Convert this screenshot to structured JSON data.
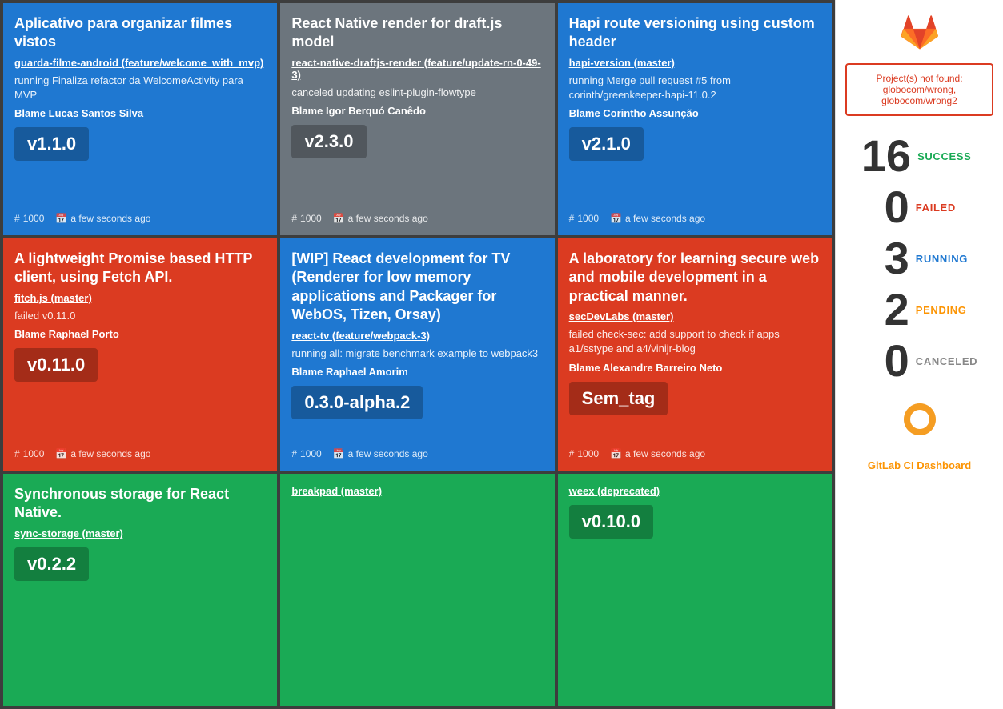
{
  "cards": [
    {
      "id": "card-1",
      "status": "blue",
      "title": "Aplicativo para organizar filmes vistos",
      "repo": "guarda-filme-android (feature/welcome_with_mvp)",
      "description": "running Finaliza refactor da WelcomeActivity para MVP",
      "blame": "Blame Lucas Santos Silva",
      "version": "v1.1.0",
      "build_number": "1000",
      "time": "a few seconds ago"
    },
    {
      "id": "card-2",
      "status": "gray",
      "title": "React Native render for draft.js model",
      "repo": "react-native-draftjs-render (feature/update-rn-0-49-3)",
      "description": "canceled updating eslint-plugin-flowtype",
      "blame": "Blame Igor Berquó Canêdo",
      "version": "v2.3.0",
      "build_number": "1000",
      "time": "a few seconds ago"
    },
    {
      "id": "card-3",
      "status": "blue",
      "title": "Hapi route versioning using custom header",
      "repo": "hapi-version (master)",
      "description": "running Merge pull request #5 from corinth/greenkeeper-hapi-11.0.2",
      "blame": "Blame Corintho Assunção",
      "version": "v2.1.0",
      "build_number": "1000",
      "time": "a few seconds ago"
    },
    {
      "id": "card-4",
      "status": "red",
      "title": "A lightweight Promise based HTTP client, using Fetch API.",
      "repo": "fitch.js (master)",
      "description": "failed v0.11.0",
      "blame": "Blame Raphael Porto",
      "version": "v0.11.0",
      "build_number": "1000",
      "time": "a few seconds ago"
    },
    {
      "id": "card-5",
      "status": "blue",
      "title": "[WIP] React development for TV (Renderer for low memory applications and Packager for WebOS, Tizen, Orsay)",
      "repo": "react-tv (feature/webpack-3)",
      "description": "running all: migrate benchmark example to webpack3",
      "blame": "Blame Raphael Amorim",
      "version": "0.3.0-alpha.2",
      "build_number": "1000",
      "time": "a few seconds ago"
    },
    {
      "id": "card-6",
      "status": "red",
      "title": "A laboratory for learning secure web and mobile development in a practical manner.",
      "repo": "secDevLabs (master)",
      "description": "failed check-sec: add support to check if apps a1/sstype and a4/vinijr-blog",
      "blame": "Blame Alexandre Barreiro Neto",
      "version": "Sem_tag",
      "build_number": "1000",
      "time": "a few seconds ago"
    },
    {
      "id": "card-7",
      "status": "green",
      "title": "Synchronous storage for React Native.",
      "repo": "sync-storage (master)",
      "description": "",
      "blame": "",
      "version": "v0.2.2",
      "build_number": "",
      "time": ""
    },
    {
      "id": "card-8",
      "status": "green",
      "title": "",
      "repo": "breakpad (master)",
      "description": "",
      "blame": "",
      "version": "",
      "build_number": "",
      "time": ""
    },
    {
      "id": "card-9",
      "status": "green",
      "title": "",
      "repo": "weex (deprecated)",
      "description": "",
      "blame": "",
      "version": "v0.10.0",
      "build_number": "",
      "time": ""
    }
  ],
  "sidebar": {
    "error_title": "Project(s) not found:",
    "error_projects": "globocom/wrong, globocom/wrong2",
    "stats": [
      {
        "number": "16",
        "label": "SUCCESS",
        "class": "success"
      },
      {
        "number": "0",
        "label": "FAILED",
        "class": "failed"
      },
      {
        "number": "3",
        "label": "RUNNING",
        "class": "running"
      },
      {
        "number": "2",
        "label": "PENDING",
        "class": "pending"
      },
      {
        "number": "0",
        "label": "CANCELED",
        "class": "canceled"
      }
    ],
    "footer_link": "GitLab CI Dashboard"
  }
}
